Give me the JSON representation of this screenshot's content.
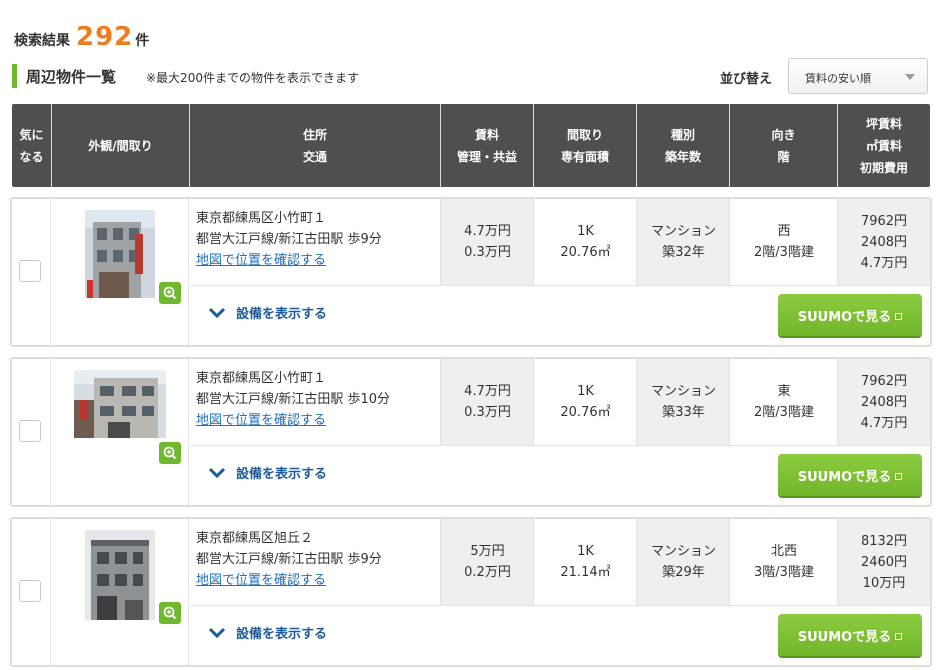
{
  "summary": {
    "label": "検索結果",
    "count": "292",
    "unit": "件"
  },
  "section": {
    "title": "周辺物件一覧",
    "note": "※最大200件までの物件を表示できます"
  },
  "sort": {
    "label": "並び替え",
    "value": "賃料の安い順"
  },
  "colors": {
    "accent_green": "#6fb92c",
    "count_orange": "#ee7d20",
    "header_bg": "#4f4f4f",
    "link_blue": "#1f6fbf"
  },
  "table_header": {
    "fav": [
      "気に",
      "なる"
    ],
    "photo": "外観/間取り",
    "address": [
      "住所",
      "交通"
    ],
    "rent": [
      "賃料",
      "管理・共益"
    ],
    "layout": [
      "間取り",
      "専有面積"
    ],
    "type": [
      "種別",
      "築年数"
    ],
    "direction": [
      "向き",
      "階"
    ],
    "unit_price": [
      "坪賃料",
      "㎡賃料",
      "初期費用"
    ]
  },
  "listings": [
    {
      "address": "東京都練馬区小竹町１",
      "access": "都営大江戸線/新江古田駅 歩9分",
      "map_link": "地図で位置を確認する",
      "rent": "4.7万円",
      "fee": "0.3万円",
      "layout": "1K",
      "area": "20.76㎡",
      "type": "マンション",
      "age": "築32年",
      "direction": "西",
      "floor": "2階/3階建",
      "tsubo_price": "7962円",
      "sqm_price": "2408円",
      "initial_cost": "4.7万円",
      "expand_label": "設備を表示する",
      "suumo_label": "SUUMOで見る",
      "photo_icon": "building-photo"
    },
    {
      "address": "東京都練馬区小竹町１",
      "access": "都営大江戸線/新江古田駅 歩10分",
      "map_link": "地図で位置を確認する",
      "rent": "4.7万円",
      "fee": "0.3万円",
      "layout": "1K",
      "area": "20.76㎡",
      "type": "マンション",
      "age": "築33年",
      "direction": "東",
      "floor": "2階/3階建",
      "tsubo_price": "7962円",
      "sqm_price": "2408円",
      "initial_cost": "4.7万円",
      "expand_label": "設備を表示する",
      "suumo_label": "SUUMOで見る",
      "photo_icon": "building-photo"
    },
    {
      "address": "東京都練馬区旭丘２",
      "access": "都営大江戸線/新江古田駅 歩9分",
      "map_link": "地図で位置を確認する",
      "rent": "5万円",
      "fee": "0.2万円",
      "layout": "1K",
      "area": "21.14㎡",
      "type": "マンション",
      "age": "築29年",
      "direction": "北西",
      "floor": "3階/3階建",
      "tsubo_price": "8132円",
      "sqm_price": "2460円",
      "initial_cost": "10万円",
      "expand_label": "設備を表示する",
      "suumo_label": "SUUMOで見る",
      "photo_icon": "building-photo"
    }
  ]
}
